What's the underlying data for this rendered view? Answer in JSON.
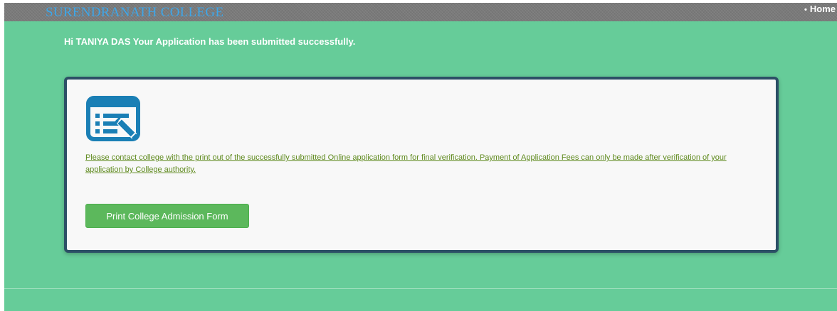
{
  "header": {
    "college_name": "SURENDRANATH COLLEGE",
    "nav_bullet": "•",
    "nav_home": "Home"
  },
  "main": {
    "greeting": "Hi TANIYA DAS Your Application has been submitted successfully.",
    "notice": "Please contact college with the print out of the successfully submitted Online application form for final verification. Payment of Application Fees can only be made after verification of your application by College authority.",
    "print_button_label": "Print College Admission Form",
    "icon": "form-edit-icon"
  },
  "colors": {
    "background": "#66cc99",
    "topbar": "#7a7a7a",
    "college_name": "#3ea6e8",
    "card_border": "#2c4f66",
    "notice_text": "#5f8a1e",
    "button": "#5cb85c",
    "icon": "#1a7fb5"
  }
}
